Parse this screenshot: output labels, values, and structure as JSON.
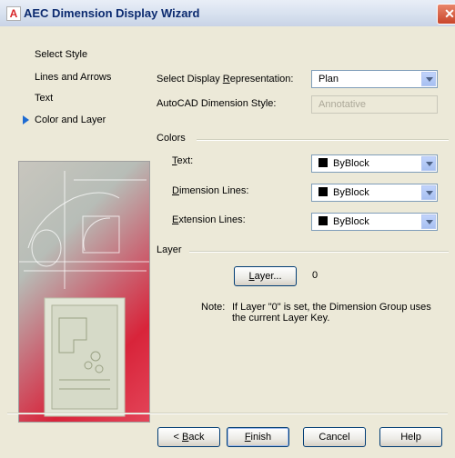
{
  "window": {
    "title": "AEC Dimension Display Wizard",
    "app_icon": "A",
    "close_glyph": "✕"
  },
  "nav": {
    "items": [
      {
        "label": "Select Style"
      },
      {
        "label": "Lines and Arrows"
      },
      {
        "label": "Text"
      },
      {
        "label": "Color and Layer"
      }
    ],
    "active_index": 3
  },
  "display_rep": {
    "label_pre": "Select Display ",
    "label_u": "R",
    "label_post": "epresentation:",
    "value": "Plan"
  },
  "dim_style": {
    "label": "AutoCAD Dimension Style:",
    "value": "Annotative"
  },
  "colors": {
    "heading": "Colors",
    "text": {
      "label_u": "T",
      "label_post": "ext:",
      "value": "ByBlock"
    },
    "dimension_lines": {
      "label_u": "D",
      "label_post": "imension Lines:",
      "value": "ByBlock"
    },
    "extension_lines": {
      "label_u": "E",
      "label_post": "xtension Lines:",
      "value": "ByBlock"
    }
  },
  "layer": {
    "heading": "Layer",
    "button_u": "L",
    "button_post": "ayer...",
    "value": "0",
    "note_label": "Note:",
    "note_line1": "If Layer \"0\" is set, the Dimension Group uses",
    "note_line2": "the current Layer Key."
  },
  "buttons": {
    "back_pre": "< ",
    "back_u": "B",
    "back_post": "ack",
    "finish_u": "F",
    "finish_post": "inish",
    "cancel": "Cancel",
    "help": "Help"
  },
  "colors_theme": {
    "accent": "#1E6BD2",
    "title_text": "#0B2A6F",
    "close": "#C9452A"
  }
}
